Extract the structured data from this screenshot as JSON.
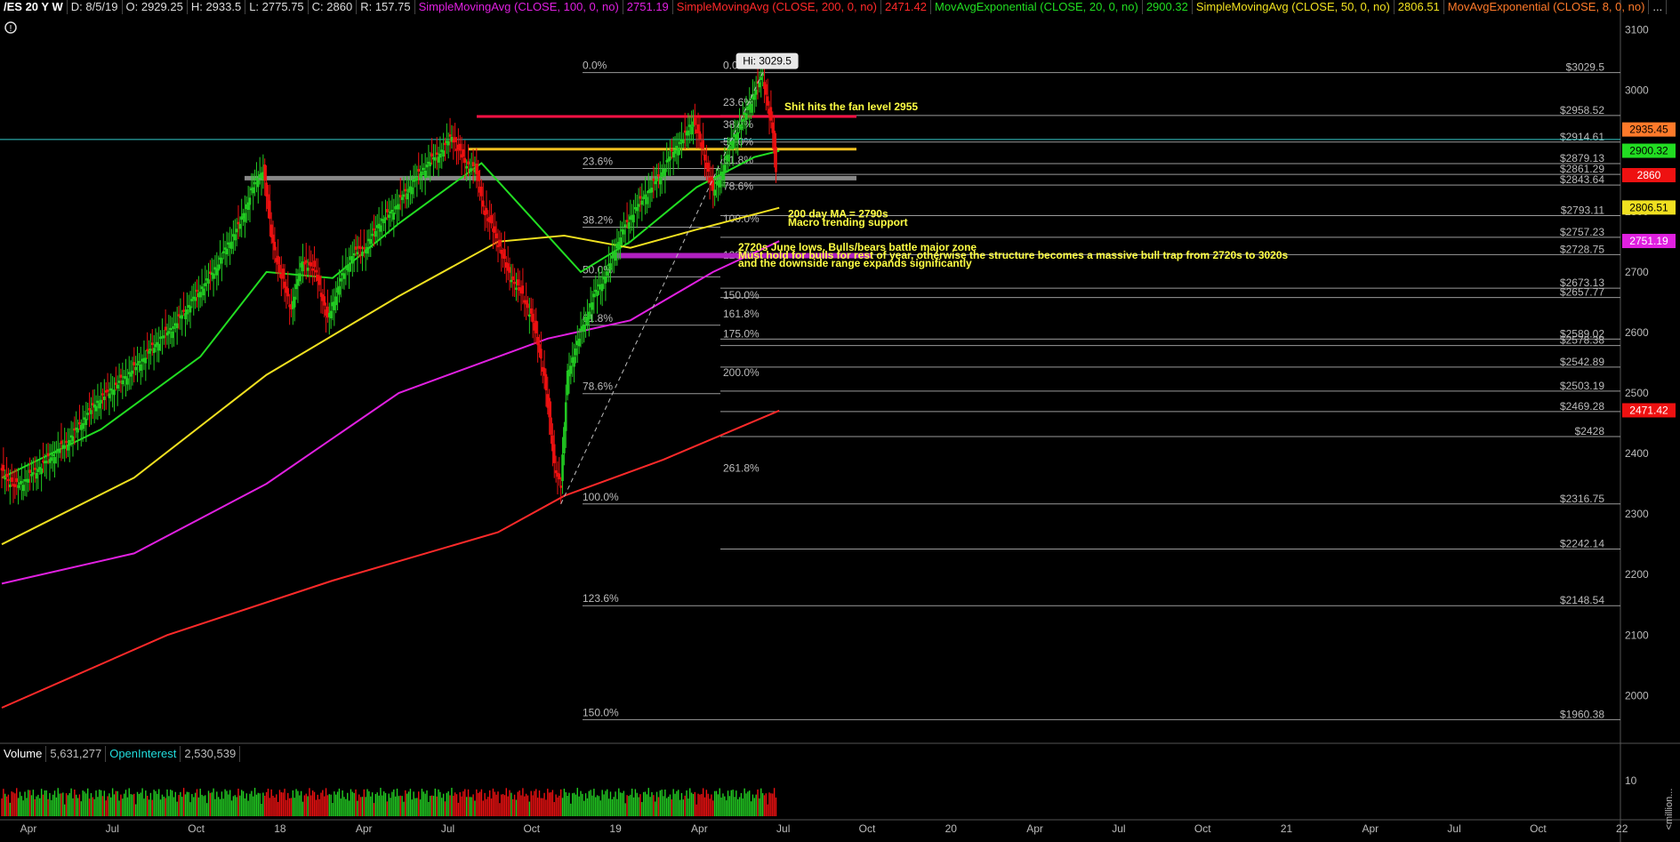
{
  "header": {
    "symbol": "/ES 20 Y W",
    "date": "D: 8/5/19",
    "open": "O: 2929.25",
    "high": "H: 2933.5",
    "low": "L: 2775.75",
    "close": "C: 2860",
    "range": "R: 157.75",
    "studies": [
      {
        "label": "SimpleMovingAvg (CLOSE, 100, 0, no)",
        "value": "2751.19",
        "color": "#e020e0"
      },
      {
        "label": "SimpleMovingAvg (CLOSE, 200, 0, no)",
        "value": "2471.42",
        "color": "#ff2a2a"
      },
      {
        "label": "MovAvgExponential (CLOSE, 20, 0, no)",
        "value": "2900.32",
        "color": "#22dd22"
      },
      {
        "label": "SimpleMovingAvg (CLOSE, 50, 0, no)",
        "value": "2806.51",
        "color": "#f0e020"
      },
      {
        "label": "MovAvgExponential (CLOSE, 8, 0, no)",
        "value": "...",
        "color": "#ff7a2a"
      }
    ]
  },
  "colors": {
    "background": "#000000",
    "up": "#22cc22",
    "down": "#ee1111",
    "grid_label": "#bbbbbb",
    "annotation": "#ffff44"
  },
  "chart_data": {
    "type": "candlestick",
    "symbol": "/ES",
    "timeframe": "W",
    "ylim": [
      1930,
      3120
    ],
    "y_ticks": [
      2000,
      2100,
      2200,
      2300,
      2400,
      2500,
      2600,
      2700,
      2800,
      2900,
      3000,
      3100
    ],
    "x_ticks": [
      "Apr",
      "Jul",
      "Oct",
      "18",
      "Apr",
      "Jul",
      "Oct",
      "19",
      "Apr",
      "Jul",
      "Oct",
      "20",
      "Apr",
      "Jul",
      "Oct",
      "21",
      "Apr",
      "Jul",
      "Oct",
      "22"
    ],
    "last_bar": {
      "date": "8/5/19",
      "open": 2929.25,
      "high": 2933.5,
      "low": 2775.75,
      "close": 2860,
      "range": 157.75
    },
    "price_path": [
      [
        0,
        2370
      ],
      [
        8,
        2345
      ],
      [
        16,
        2360
      ],
      [
        24,
        2380
      ],
      [
        32,
        2400
      ],
      [
        40,
        2420
      ],
      [
        48,
        2450
      ],
      [
        56,
        2480
      ],
      [
        64,
        2500
      ],
      [
        72,
        2520
      ],
      [
        80,
        2540
      ],
      [
        88,
        2565
      ],
      [
        96,
        2590
      ],
      [
        104,
        2610
      ],
      [
        112,
        2640
      ],
      [
        120,
        2670
      ],
      [
        128,
        2700
      ],
      [
        136,
        2740
      ],
      [
        144,
        2780
      ],
      [
        152,
        2840
      ],
      [
        158,
        2870
      ],
      [
        163,
        2760
      ],
      [
        168,
        2700
      ],
      [
        175,
        2640
      ],
      [
        182,
        2720
      ],
      [
        190,
        2700
      ],
      [
        197,
        2620
      ],
      [
        204,
        2680
      ],
      [
        212,
        2730
      ],
      [
        220,
        2740
      ],
      [
        228,
        2780
      ],
      [
        236,
        2800
      ],
      [
        244,
        2830
      ],
      [
        252,
        2860
      ],
      [
        258,
        2880
      ],
      [
        266,
        2900
      ],
      [
        272,
        2925
      ],
      [
        280,
        2880
      ],
      [
        286,
        2870
      ],
      [
        292,
        2800
      ],
      [
        300,
        2750
      ],
      [
        306,
        2700
      ],
      [
        313,
        2670
      ],
      [
        320,
        2630
      ],
      [
        328,
        2530
      ],
      [
        334,
        2380
      ],
      [
        338,
        2350
      ],
      [
        342,
        2530
      ],
      [
        350,
        2600
      ],
      [
        358,
        2660
      ],
      [
        366,
        2700
      ],
      [
        374,
        2760
      ],
      [
        382,
        2800
      ],
      [
        390,
        2830
      ],
      [
        398,
        2860
      ],
      [
        406,
        2900
      ],
      [
        412,
        2920
      ],
      [
        418,
        2950
      ],
      [
        424,
        2900
      ],
      [
        430,
        2830
      ],
      [
        436,
        2870
      ],
      [
        442,
        2920
      ],
      [
        448,
        2950
      ],
      [
        454,
        2990
      ],
      [
        460,
        3025
      ],
      [
        466,
        2930
      ],
      [
        468,
        2860
      ]
    ],
    "volume_ylim": [
      0,
      15
    ],
    "volume_ticks": [
      10
    ],
    "moving_averages": [
      {
        "name": "SMA 100",
        "color": "#e020e0",
        "value": 2751.19,
        "points": [
          [
            0,
            2185
          ],
          [
            80,
            2235
          ],
          [
            160,
            2350
          ],
          [
            240,
            2500
          ],
          [
            330,
            2590
          ],
          [
            380,
            2620
          ],
          [
            430,
            2700
          ],
          [
            470,
            2751
          ]
        ]
      },
      {
        "name": "SMA 200",
        "color": "#ff2a2a",
        "value": 2471.42,
        "points": [
          [
            0,
            1980
          ],
          [
            100,
            2100
          ],
          [
            200,
            2190
          ],
          [
            300,
            2270
          ],
          [
            340,
            2330
          ],
          [
            400,
            2390
          ],
          [
            470,
            2471
          ]
        ]
      },
      {
        "name": "EMA 20",
        "color": "#22dd22",
        "value": 2900.32,
        "points": [
          [
            0,
            2360
          ],
          [
            60,
            2440
          ],
          [
            120,
            2560
          ],
          [
            160,
            2700
          ],
          [
            200,
            2690
          ],
          [
            240,
            2780
          ],
          [
            290,
            2880
          ],
          [
            320,
            2790
          ],
          [
            350,
            2700
          ],
          [
            380,
            2750
          ],
          [
            420,
            2840
          ],
          [
            455,
            2890
          ],
          [
            470,
            2900
          ]
        ]
      },
      {
        "name": "SMA 50",
        "color": "#f0e020",
        "value": 2806.51,
        "points": [
          [
            0,
            2250
          ],
          [
            80,
            2360
          ],
          [
            160,
            2530
          ],
          [
            240,
            2660
          ],
          [
            300,
            2750
          ],
          [
            340,
            2760
          ],
          [
            380,
            2740
          ],
          [
            420,
            2770
          ],
          [
            470,
            2806
          ]
        ]
      }
    ],
    "levels": [
      {
        "price": 3029.5,
        "label": "$3029.5"
      },
      {
        "price": 2958.52,
        "label": "$2958.52"
      },
      {
        "price": 2914.61,
        "label": "$2914.61"
      },
      {
        "price": 2879.13,
        "label": "$2879.13"
      },
      {
        "price": 2861.29,
        "label": "$2861.29"
      },
      {
        "price": 2843.64,
        "label": "$2843.64"
      },
      {
        "price": 2793.11,
        "label": "$2793.11"
      },
      {
        "price": 2757.23,
        "label": "$2757.23"
      },
      {
        "price": 2728.75,
        "label": "$2728.75"
      },
      {
        "price": 2673.13,
        "label": "$2673.13"
      },
      {
        "price": 2657.77,
        "label": "$2657.77"
      },
      {
        "price": 2589.02,
        "label": "$2589.02"
      },
      {
        "price": 2578.38,
        "label": "$2578.38"
      },
      {
        "price": 2542.89,
        "label": "$2542.89"
      },
      {
        "price": 2503.19,
        "label": "$2503.19"
      },
      {
        "price": 2469.28,
        "label": "$2469.28"
      },
      {
        "price": 2428,
        "label": "$2428"
      },
      {
        "price": 2316.75,
        "label": "$2316.75"
      },
      {
        "price": 2242.14,
        "label": "$2242.14"
      },
      {
        "price": 2148.54,
        "label": "$2148.54"
      },
      {
        "price": 1960.38,
        "label": "$1960.38"
      }
    ],
    "fib_labels": [
      {
        "text": "0.0%",
        "price": 3029.5,
        "set": "a"
      },
      {
        "text": "23.6%",
        "price": 2871,
        "set": "a"
      },
      {
        "text": "38.2%",
        "price": 2774,
        "set": "a"
      },
      {
        "text": "50.0%",
        "price": 2692,
        "set": "a"
      },
      {
        "text": "61.8%",
        "price": 2612,
        "set": "a"
      },
      {
        "text": "78.6%",
        "price": 2499,
        "set": "a"
      },
      {
        "text": "100.0%",
        "price": 2316.75,
        "set": "a"
      },
      {
        "text": "123.6%",
        "price": 2148.54,
        "set": "a"
      },
      {
        "text": "150.0%",
        "price": 1960.38,
        "set": "a"
      },
      {
        "text": "0.0%",
        "price": 3029.5,
        "set": "b"
      },
      {
        "text": "23.6%",
        "price": 2969,
        "set": "b"
      },
      {
        "text": "38.2%",
        "price": 2932,
        "set": "b"
      },
      {
        "text": "50.0%",
        "price": 2903,
        "set": "b"
      },
      {
        "text": "61.8%",
        "price": 2873,
        "set": "b"
      },
      {
        "text": "78.6%",
        "price": 2830,
        "set": "b"
      },
      {
        "text": "100.0%",
        "price": 2776,
        "set": "b"
      },
      {
        "text": "123.6%",
        "price": 2716,
        "set": "b"
      },
      {
        "text": "150.0%",
        "price": 2650,
        "set": "b"
      },
      {
        "text": "161.8%",
        "price": 2619,
        "set": "b"
      },
      {
        "text": "175.0%",
        "price": 2586,
        "set": "b"
      },
      {
        "text": "200.0%",
        "price": 2522,
        "set": "b"
      },
      {
        "text": "261.8%",
        "price": 2364,
        "set": "b"
      }
    ],
    "right_tags": [
      {
        "label": "2935.45",
        "price": 2935.45,
        "color": "#ff7a2a",
        "text": "#000000"
      },
      {
        "label": "2900.32",
        "price": 2900.32,
        "color": "#22dd22",
        "text": "#000000"
      },
      {
        "label": "2860",
        "price": 2860,
        "color": "#ee1111",
        "text": "#ffffff"
      },
      {
        "label": "2806.51",
        "price": 2806.51,
        "color": "#f0e020",
        "text": "#000000"
      },
      {
        "label": "2751.19",
        "price": 2751.19,
        "color": "#e020e0",
        "text": "#ffffff"
      },
      {
        "label": "2471.42",
        "price": 2471.42,
        "color": "#ee1111",
        "text": "#ffffff"
      }
    ],
    "high_label": "Hi: 3029.5",
    "annotations": [
      {
        "text": "Shit hits the fan level 2955"
      },
      {
        "text": "200 day MA = 2790s"
      },
      {
        "text": "Macro trending support"
      },
      {
        "text": "2720s June lows. Bulls/bears battle major zone"
      },
      {
        "text": "Must hold for bulls for rest of year, otherwise the structure becomes a massive bull trap from 2720s to 3020s"
      },
      {
        "text": "and the downside range expands significantly"
      }
    ],
    "volume_label": "Volume",
    "volume_value": "5,631,277",
    "oi_label": "OpenInterest",
    "oi_value": "2,530,539",
    "volume_unit": "<million..."
  }
}
